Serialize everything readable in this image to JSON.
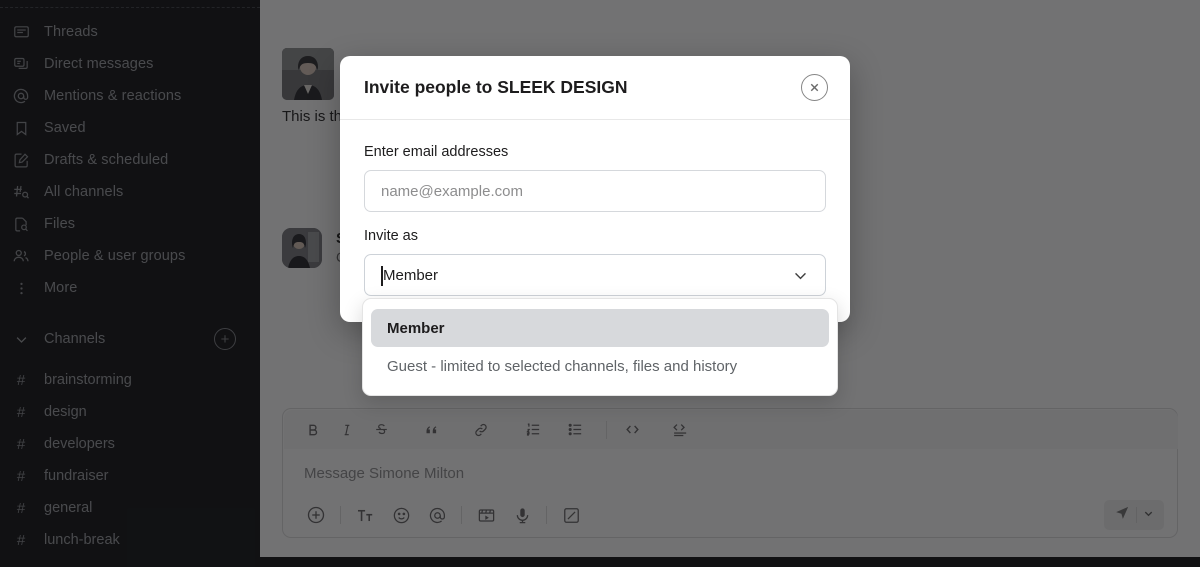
{
  "sidebar": {
    "nav_items": [
      {
        "label": "Threads",
        "icon": "threads-icon"
      },
      {
        "label": "Direct messages",
        "icon": "direct-messages-icon"
      },
      {
        "label": "Mentions & reactions",
        "icon": "at-mention-icon"
      },
      {
        "label": "Saved",
        "icon": "bookmark-icon"
      },
      {
        "label": "Drafts & scheduled",
        "icon": "draft-pencil-icon"
      },
      {
        "label": "All channels",
        "icon": "all-channels-icon"
      },
      {
        "label": "Files",
        "icon": "file-search-icon"
      },
      {
        "label": "People & user groups",
        "icon": "people-icon"
      },
      {
        "label": "More",
        "icon": "more-dots-icon"
      }
    ],
    "channels_section": {
      "title": "Channels",
      "add_label": "+",
      "channels": [
        {
          "hash": "#",
          "name": "brainstorming"
        },
        {
          "hash": "#",
          "name": "design"
        },
        {
          "hash": "#",
          "name": "developers"
        },
        {
          "hash": "#",
          "name": "fundraiser"
        },
        {
          "hash": "#",
          "name": "general"
        },
        {
          "hash": "#",
          "name": "lunch-break"
        }
      ]
    }
  },
  "main": {
    "message_one": {
      "text": "This is th"
    },
    "message_two": {
      "name": "S",
      "sub": "C"
    },
    "composer": {
      "placeholder": "Message Simone Milton",
      "format_buttons": [
        {
          "name": "bold-icon",
          "glyph": "B"
        },
        {
          "name": "italic-icon",
          "glyph": "I"
        },
        {
          "name": "strikethrough-icon",
          "glyph": "S"
        },
        {
          "name": "blockquote-icon",
          "glyph": "”"
        },
        {
          "name": "link-icon",
          "glyph": "link"
        },
        {
          "name": "ordered-list-icon",
          "glyph": "ol"
        },
        {
          "name": "bulleted-list-icon",
          "glyph": "ul"
        },
        {
          "name": "code-icon",
          "glyph": "<>"
        },
        {
          "name": "code-block-icon",
          "glyph": "cb"
        }
      ],
      "action_buttons": [
        {
          "name": "plus-icon"
        },
        {
          "name": "text-format-icon"
        },
        {
          "name": "emoji-icon"
        },
        {
          "name": "mention-icon"
        },
        {
          "name": "video-clip-icon"
        },
        {
          "name": "microphone-icon"
        },
        {
          "name": "audio-clip-icon"
        }
      ],
      "send_label": "send-icon",
      "send_caret": "chevron-down-icon"
    }
  },
  "modal": {
    "title": "Invite people to SLEEK DESIGN",
    "close_label": "×",
    "email_label": "Enter email addresses",
    "email_placeholder": "name@example.com",
    "email_value": "",
    "invite_as_label": "Invite as",
    "selected_role": "Member",
    "role_options": [
      {
        "label": "Member",
        "selected": true
      },
      {
        "label": "Guest - limited to selected channels, files and history",
        "selected": false
      }
    ]
  },
  "colors": {
    "sidebar_bg": "#0d0e11",
    "modal_bg": "#ffffff",
    "overlay": "rgba(20,20,22,0.60)",
    "option_selected_bg": "#d7d9dc",
    "text_primary": "#1d1c1d",
    "text_muted": "#616061"
  }
}
